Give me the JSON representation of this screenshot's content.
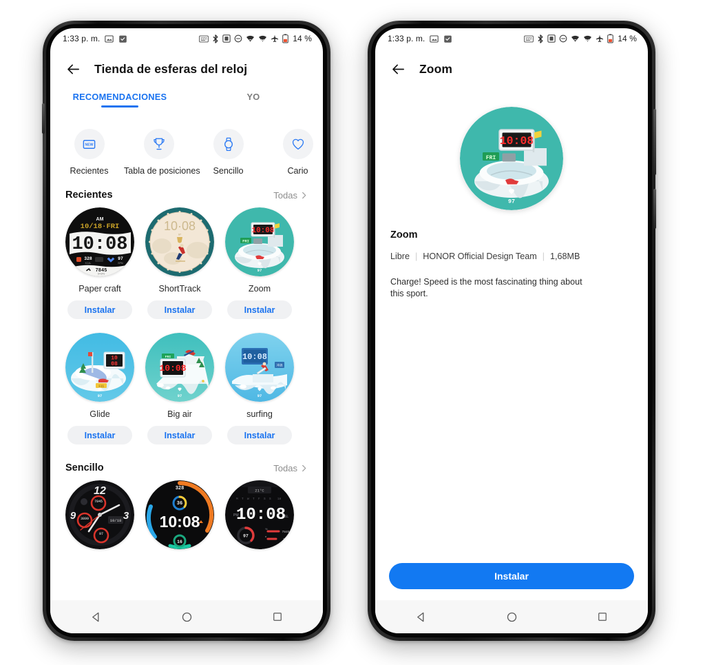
{
  "status_bar": {
    "time": "1:33 p. m.",
    "left_icons": [
      "screenshot-icon",
      "shield-check-icon"
    ],
    "right_icons": [
      "nfc-icon",
      "bluetooth-icon",
      "vibrate-icon",
      "dnd-icon",
      "wifi-icon",
      "signal-icon",
      "airplane-icon"
    ],
    "battery_level": "14 %"
  },
  "colors": {
    "accent": "#1a73f0",
    "install_button": "#1279f2",
    "chip_bg": "#f0f1f3",
    "nav_bg": "#f7f7f7"
  },
  "left_phone": {
    "appbar": {
      "back": "back-arrow-icon",
      "title": "Tienda de esferas del reloj"
    },
    "tabs": [
      {
        "label": "RECOMENDACIONES",
        "active": true
      },
      {
        "label": "YO",
        "active": false
      }
    ],
    "categories": [
      {
        "label": "Recientes",
        "icon": "new-badge-icon"
      },
      {
        "label": "Tabla de posiciones",
        "icon": "trophy-icon"
      },
      {
        "label": "Sencillo",
        "icon": "watch-icon"
      },
      {
        "label": "Cario",
        "icon": "heart-icon"
      }
    ],
    "sections": [
      {
        "title": "Recientes",
        "more_label": "Todas",
        "rows": [
          [
            {
              "name": "Paper craft",
              "button": "Instalar",
              "art": "papercraft"
            },
            {
              "name": "ShortTrack",
              "button": "Instalar",
              "art": "shorttrack"
            },
            {
              "name": "Zoom",
              "button": "Instalar",
              "art": "zoom"
            }
          ],
          [
            {
              "name": "Glide",
              "button": "Instalar",
              "art": "glide"
            },
            {
              "name": "Big air",
              "button": "Instalar",
              "art": "bigair"
            },
            {
              "name": "surfing",
              "button": "Instalar",
              "art": "surfing"
            }
          ]
        ]
      },
      {
        "title": "Sencillo",
        "more_label": "Todas",
        "rows": [
          [
            {
              "name": "",
              "button": "",
              "art": "analog-dark"
            },
            {
              "name": "",
              "button": "",
              "art": "digital-rings"
            },
            {
              "name": "",
              "button": "",
              "art": "digital-dash"
            }
          ]
        ]
      }
    ],
    "nav": [
      "back-triangle-icon",
      "home-circle-icon",
      "recents-square-icon"
    ]
  },
  "right_phone": {
    "appbar": {
      "back": "back-arrow-icon",
      "title": "Zoom"
    },
    "hero_art": "zoom",
    "title": "Zoom",
    "meta": {
      "price": "Libre",
      "author": "HONOR Official Design Team",
      "size": "1,68MB"
    },
    "description": "Charge! Speed is the most fascinating thing about this sport.",
    "install_label": "Instalar",
    "nav": [
      "back-triangle-icon",
      "home-circle-icon",
      "recents-square-icon"
    ]
  },
  "watch_face_art": {
    "zoom_time": "10:08",
    "zoom_day": "FRI",
    "zoom_hr": "97",
    "papercraft_time": "10:08",
    "papercraft_ampm": "AM",
    "papercraft_day": "FRI",
    "papercraft_steps": "7845",
    "papercraft_cal": "328",
    "papercraft_hr": "97",
    "shorttrack_time": "10:08",
    "digital_time": "10:08",
    "dash_time": "10:08",
    "rings_top": "328",
    "rings_mid": "36",
    "rings_bottom": "16",
    "dash_temp": "21°C",
    "dash_hr": "97"
  }
}
